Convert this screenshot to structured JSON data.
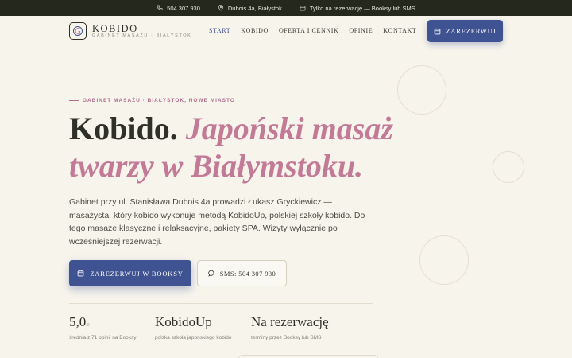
{
  "topbar": {
    "phone": "504 307 930",
    "address": "Dubois 4a, Białystok",
    "booking": "Tylko na rezerwację — Booksy lub SMS"
  },
  "header": {
    "logo_name": "KOBIDO",
    "logo_sub": "GABINET MASAŻU · BIAŁYSTOK",
    "nav": [
      "START",
      "KOBIDO",
      "OFERTA I CENNIK",
      "OPINIE",
      "KONTAKT"
    ],
    "active_nav": "START",
    "cta": "ZAREZERWUJ"
  },
  "hero": {
    "eyebrow": "GABINET MASAŻU · BIAŁYSTOK, NOWE MIASTO",
    "title_plain": "Kobido.",
    "title_accent": "Japoński masaż twarzy w Białymstoku.",
    "lead": "Gabinet przy ul. Stanisława Dubois 4a prowadzi Łukasz Gryckiewicz — masażysta, który kobido wykonuje metodą KobidoUp, polskiej szkoły kobido. Do tego masaże klasyczne i relaksacyjne, pakiety SPA. Wizyty wyłącznie po wcześniejszej rezerwacji.",
    "primary_button": "ZAREZERWUJ W BOOKSY",
    "secondary_button": "SMS: 504 307 930"
  },
  "stats": [
    {
      "value": "5,0",
      "suffix": "/5",
      "label": "średnia z 71 opinii na Booksy"
    },
    {
      "value": "KobidoUp",
      "suffix": "",
      "label": "polska szkoła japońskiego kobido"
    },
    {
      "value": "Na rezerwację",
      "suffix": "",
      "label": "terminy przez Booksy lub SMS"
    }
  ],
  "colors": {
    "accent_blue": "#3f5291",
    "accent_pink": "#c27a97",
    "topbar_bg": "#24281d",
    "page_bg": "#f7f4ec"
  }
}
